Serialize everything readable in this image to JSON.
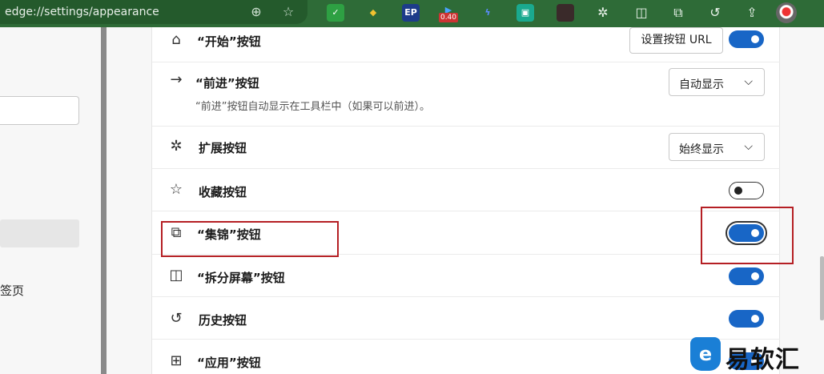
{
  "browser": {
    "url": "edge://settings/appearance",
    "extensions": [
      {
        "icon": "shield-ext-icon",
        "label": "✓",
        "color": "#2ea043"
      },
      {
        "icon": "tiger-ext-icon",
        "label": "🐯",
        "color": "#2e6b37"
      },
      {
        "icon": "ep-ext-icon",
        "label": "EP",
        "color": "#1d3c8a"
      },
      {
        "icon": "play-ext-icon",
        "label": "▶",
        "color": "#2e6b37"
      },
      {
        "icon": "bolt-ext-icon",
        "label": "⚡",
        "color": "#2e6b37"
      },
      {
        "icon": "square-ext-icon",
        "label": "▣",
        "color": "#1aa98f"
      },
      {
        "icon": "photo-ext-icon",
        "label": "",
        "color": "#3a2a2a"
      }
    ],
    "badge": "0.40"
  },
  "left": {
    "item_text": "签页"
  },
  "rows": [
    {
      "icon": "home-icon",
      "glyph": "⌂",
      "label": "“开始”按钮",
      "control": "button+toggle",
      "button_label": "设置按钮 URL",
      "on": true
    },
    {
      "icon": "forward-arrow-icon",
      "glyph": "→",
      "label": "“前进”按钮",
      "desc": "“前进”按钮自动显示在工具栏中（如果可以前进）。",
      "control": "dropdown",
      "value": "自动显示"
    },
    {
      "icon": "extensions-puzzle-icon",
      "glyph": "✲",
      "label": "扩展按钮",
      "control": "dropdown",
      "value": "始终显示"
    },
    {
      "icon": "favorites-star-icon",
      "glyph": "☆",
      "label": "收藏按钮",
      "control": "toggle",
      "on": false
    },
    {
      "icon": "collections-icon",
      "glyph": "⧉",
      "label": "“集锦”按钮",
      "control": "toggle",
      "on": true
    },
    {
      "icon": "split-screen-icon",
      "glyph": "◫",
      "label": "“拆分屏幕”按钮",
      "control": "toggle",
      "on": true
    },
    {
      "icon": "history-icon",
      "glyph": "↺",
      "label": "历史按钮",
      "control": "toggle",
      "on": true
    },
    {
      "icon": "apps-icon",
      "glyph": "⊞",
      "label": "“应用”按钮",
      "control": "toggle",
      "on": true
    }
  ],
  "watermark": {
    "logo": "e",
    "text": "易软汇"
  },
  "colors": {
    "toolbar": "#2e6b37",
    "toggle_on": "#1866c6",
    "highlight": "#b51f24"
  }
}
